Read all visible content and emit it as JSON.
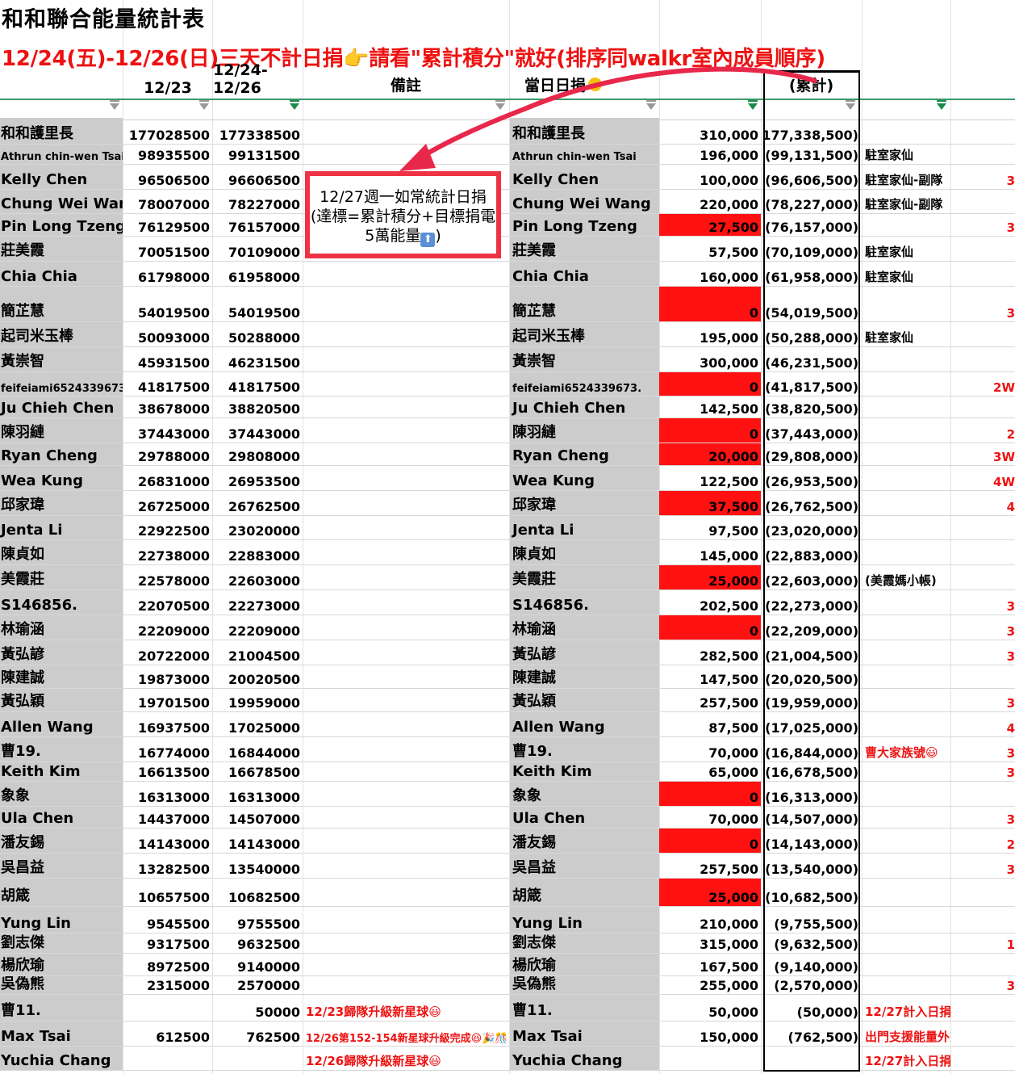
{
  "sheet_title": "和和聯合能量統計表",
  "subtitle": "12/24(五)-12/26(日)三天不計日捐👉請看\"累計積分\"就好(排序同walkr室內成員順序)",
  "headers": {
    "col_1223": "12/23",
    "col_1224_1226": "12/24-12/26",
    "col_note": "備註",
    "col_daily": "當日日捐",
    "col_cum": "(累計)"
  },
  "callout": {
    "text": "12/27週一如常統計日捐(達標=累計積分+目標捐電5萬能量",
    "icon": "up-arrow-icon",
    "closing": ")"
  },
  "colors": {
    "red": "#ff1111",
    "gray": "#cccccc",
    "accent": "#ee1111"
  },
  "rows": [
    {
      "name": "和和護里長",
      "v1": "177028500",
      "v2": "177338500",
      "note": "",
      "name2": "和和護里長",
      "daily": "310,000",
      "red": false,
      "cum": "(177,338,500)",
      "remark": "",
      "remark_red": false,
      "extra": ""
    },
    {
      "name": "Athrun chin-wen Tsai",
      "v1": "98935500",
      "v2": "99131500",
      "note": "",
      "name2": "Athrun chin-wen Tsai",
      "daily": "196,000",
      "red": false,
      "cum": "(99,131,500)",
      "remark": "駐室家仙",
      "remark_red": false,
      "extra": ""
    },
    {
      "name": "Kelly Chen",
      "v1": "96506500",
      "v2": "96606500",
      "note": "",
      "name2": "Kelly Chen",
      "daily": "100,000",
      "red": false,
      "cum": "(96,606,500)",
      "remark": "駐室家仙-副隊",
      "remark_red": false,
      "extra": "3"
    },
    {
      "name": "Chung Wei Wang",
      "v1": "78007000",
      "v2": "78227000",
      "note": "",
      "name2": "Chung Wei Wang",
      "daily": "220,000",
      "red": false,
      "cum": "(78,227,000)",
      "remark": "駐室家仙-副隊",
      "remark_red": false,
      "extra": ""
    },
    {
      "name": "Pin Long Tzeng",
      "v1": "76129500",
      "v2": "76157000",
      "note": "",
      "name2": "Pin Long Tzeng",
      "daily": "27,500",
      "red": true,
      "cum": "(76,157,000)",
      "remark": "",
      "remark_red": false,
      "extra": "3"
    },
    {
      "name": "莊美霞",
      "v1": "70051500",
      "v2": "70109000",
      "note": "",
      "name2": "莊美霞",
      "daily": "57,500",
      "red": false,
      "cum": "(70,109,000)",
      "remark": "駐室家仙",
      "remark_red": false,
      "extra": ""
    },
    {
      "name": "Chia Chia",
      "v1": "61798000",
      "v2": "61958000",
      "note": "",
      "name2": "Chia Chia",
      "daily": "160,000",
      "red": false,
      "cum": "(61,958,000)",
      "remark": "駐室家仙",
      "remark_red": false,
      "extra": ""
    },
    {
      "name": "簡芷慧",
      "v1": "54019500",
      "v2": "54019500",
      "note": "",
      "name2": "簡芷慧",
      "daily": "0",
      "red": true,
      "cum": "(54,019,500)",
      "remark": "",
      "remark_red": false,
      "extra": "3"
    },
    {
      "name": "起司米玉棒",
      "v1": "50093000",
      "v2": "50288000",
      "note": "",
      "name2": "起司米玉棒",
      "daily": "195,000",
      "red": false,
      "cum": "(50,288,000)",
      "remark": "駐室家仙",
      "remark_red": false,
      "extra": ""
    },
    {
      "name": "黃崇智",
      "v1": "45931500",
      "v2": "46231500",
      "note": "",
      "name2": "黃崇智",
      "daily": "300,000",
      "red": false,
      "cum": "(46,231,500)",
      "remark": "",
      "remark_red": false,
      "extra": ""
    },
    {
      "name": "feifeiami6524339673.",
      "v1": "41817500",
      "v2": "41817500",
      "note": "",
      "name2": "feifeiami6524339673.",
      "daily": "0",
      "red": true,
      "cum": "(41,817,500)",
      "remark": "",
      "remark_red": false,
      "extra": "2W"
    },
    {
      "name": "Ju Chieh Chen",
      "v1": "38678000",
      "v2": "38820500",
      "note": "",
      "name2": "Ju Chieh Chen",
      "daily": "142,500",
      "red": false,
      "cum": "(38,820,500)",
      "remark": "",
      "remark_red": false,
      "extra": ""
    },
    {
      "name": "陳羽縺",
      "v1": "37443000",
      "v2": "37443000",
      "note": "",
      "name2": "陳羽縺",
      "daily": "0",
      "red": true,
      "cum": "(37,443,000)",
      "remark": "",
      "remark_red": false,
      "extra": "2"
    },
    {
      "name": "Ryan Cheng",
      "v1": "29788000",
      "v2": "29808000",
      "note": "",
      "name2": "Ryan Cheng",
      "daily": "20,000",
      "red": true,
      "cum": "(29,808,000)",
      "remark": "",
      "remark_red": false,
      "extra": "3W"
    },
    {
      "name": "Wea Kung",
      "v1": "26831000",
      "v2": "26953500",
      "note": "",
      "name2": "Wea Kung",
      "daily": "122,500",
      "red": false,
      "cum": "(26,953,500)",
      "remark": "",
      "remark_red": false,
      "extra": "4W"
    },
    {
      "name": "邱家瑋",
      "v1": "26725000",
      "v2": "26762500",
      "note": "",
      "name2": "邱家瑋",
      "daily": "37,500",
      "red": true,
      "cum": "(26,762,500)",
      "remark": "",
      "remark_red": false,
      "extra": "4"
    },
    {
      "name": "Jenta Li",
      "v1": "22922500",
      "v2": "23020000",
      "note": "",
      "name2": "Jenta Li",
      "daily": "97,500",
      "red": false,
      "cum": "(23,020,000)",
      "remark": "",
      "remark_red": false,
      "extra": ""
    },
    {
      "name": "陳貞如",
      "v1": "22738000",
      "v2": "22883000",
      "note": "",
      "name2": "陳貞如",
      "daily": "145,000",
      "red": false,
      "cum": "(22,883,000)",
      "remark": "",
      "remark_red": false,
      "extra": ""
    },
    {
      "name": "美霞莊",
      "v1": "22578000",
      "v2": "22603000",
      "note": "",
      "name2": "美霞莊",
      "daily": "25,000",
      "red": true,
      "cum": "(22,603,000)",
      "remark": "(美霞媽小帳)",
      "remark_red": false,
      "extra": ""
    },
    {
      "name": "S146856.",
      "v1": "22070500",
      "v2": "22273000",
      "note": "",
      "name2": "S146856.",
      "daily": "202,500",
      "red": false,
      "cum": "(22,273,000)",
      "remark": "",
      "remark_red": false,
      "extra": "3"
    },
    {
      "name": "林瑜涵",
      "v1": "22209000",
      "v2": "22209000",
      "note": "",
      "name2": "林瑜涵",
      "daily": "0",
      "red": true,
      "cum": "(22,209,000)",
      "remark": "",
      "remark_red": false,
      "extra": "3"
    },
    {
      "name": "黃弘諺",
      "v1": "20722000",
      "v2": "21004500",
      "note": "",
      "name2": "黃弘諺",
      "daily": "282,500",
      "red": false,
      "cum": "(21,004,500)",
      "remark": "",
      "remark_red": false,
      "extra": "3"
    },
    {
      "name": "陳建誠",
      "v1": "19873000",
      "v2": "20020500",
      "note": "",
      "name2": "陳建誠",
      "daily": "147,500",
      "red": false,
      "cum": "(20,020,500)",
      "remark": "",
      "remark_red": false,
      "extra": ""
    },
    {
      "name": "黃弘穎",
      "v1": "19701500",
      "v2": "19959000",
      "note": "",
      "name2": "黃弘穎",
      "daily": "257,500",
      "red": false,
      "cum": "(19,959,000)",
      "remark": "",
      "remark_red": false,
      "extra": "3"
    },
    {
      "name": "Allen Wang",
      "v1": "16937500",
      "v2": "17025000",
      "note": "",
      "name2": "Allen Wang",
      "daily": "87,500",
      "red": false,
      "cum": "(17,025,000)",
      "remark": "",
      "remark_red": false,
      "extra": "4"
    },
    {
      "name": "曹19.",
      "v1": "16774000",
      "v2": "16844000",
      "note": "",
      "name2": "曹19.",
      "daily": "70,000",
      "red": false,
      "cum": "(16,844,000)",
      "remark": "曹大家族號😃",
      "remark_red": true,
      "extra": "3"
    },
    {
      "name": "Keith Kim",
      "v1": "16613500",
      "v2": "16678500",
      "note": "",
      "name2": "Keith Kim",
      "daily": "65,000",
      "red": false,
      "cum": "(16,678,500)",
      "remark": "",
      "remark_red": false,
      "extra": "3"
    },
    {
      "name": "象象",
      "v1": "16313000",
      "v2": "16313000",
      "note": "",
      "name2": "象象",
      "daily": "0",
      "red": true,
      "cum": "(16,313,000)",
      "remark": "",
      "remark_red": false,
      "extra": ""
    },
    {
      "name": "Ula Chen",
      "v1": "14437000",
      "v2": "14507000",
      "note": "",
      "name2": "Ula Chen",
      "daily": "70,000",
      "red": false,
      "cum": "(14,507,000)",
      "remark": "",
      "remark_red": false,
      "extra": "3"
    },
    {
      "name": "潘友錫",
      "v1": "14143000",
      "v2": "14143000",
      "note": "",
      "name2": "潘友錫",
      "daily": "0",
      "red": true,
      "cum": "(14,143,000)",
      "remark": "",
      "remark_red": false,
      "extra": "2"
    },
    {
      "name": "吳昌益",
      "v1": "13282500",
      "v2": "13540000",
      "note": "",
      "name2": "吳昌益",
      "daily": "257,500",
      "red": false,
      "cum": "(13,540,000)",
      "remark": "",
      "remark_red": false,
      "extra": "3"
    },
    {
      "name": "胡箴",
      "v1": "10657500",
      "v2": "10682500",
      "note": "",
      "name2": "胡箴",
      "daily": "25,000",
      "red": true,
      "cum": "(10,682,500)",
      "remark": "",
      "remark_red": false,
      "extra": ""
    },
    {
      "name": "Yung Lin",
      "v1": "9545500",
      "v2": "9755500",
      "note": "",
      "name2": "Yung Lin",
      "daily": "210,000",
      "red": false,
      "cum": "(9,755,500)",
      "remark": "",
      "remark_red": false,
      "extra": ""
    },
    {
      "name": "劉志傑",
      "v1": "9317500",
      "v2": "9632500",
      "note": "",
      "name2": "劉志傑",
      "daily": "315,000",
      "red": false,
      "cum": "(9,632,500)",
      "remark": "",
      "remark_red": false,
      "extra": "1"
    },
    {
      "name": "楊欣瑜",
      "v1": "8972500",
      "v2": "9140000",
      "note": "",
      "name2": "楊欣瑜",
      "daily": "167,500",
      "red": false,
      "cum": "(9,140,000)",
      "remark": "",
      "remark_red": false,
      "extra": ""
    },
    {
      "name": "吳偽熊",
      "v1": "2315000",
      "v2": "2570000",
      "note": "",
      "name2": "吳偽熊",
      "daily": "255,000",
      "red": false,
      "cum": "(2,570,000)",
      "remark": "",
      "remark_red": false,
      "extra": "3"
    },
    {
      "name": "曹11.",
      "v1": "",
      "v2": "50000",
      "note": "12/23歸隊升級新星球😃",
      "name2": "曹11.",
      "daily": "50,000",
      "red": false,
      "cum": "(50,000)",
      "remark": "12/27計入日捐",
      "remark_red": true,
      "extra": ""
    },
    {
      "name": "Max Tsai",
      "v1": "612500",
      "v2": "762500",
      "note": "12/26第152-154新星球升級完成😆🎉🎊",
      "name2": "Max Tsai",
      "daily": "150,000",
      "red": false,
      "cum": "(762,500)",
      "remark": "出門支援能量外交🙇",
      "remark_red": true,
      "extra": ""
    },
    {
      "name": "Yuchia Chang",
      "v1": "",
      "v2": "",
      "note": "12/26歸隊升級新星球😃",
      "name2": "Yuchia Chang",
      "daily": "",
      "red": false,
      "cum": "",
      "remark": "12/27計入日捐",
      "remark_red": true,
      "extra": ""
    }
  ]
}
